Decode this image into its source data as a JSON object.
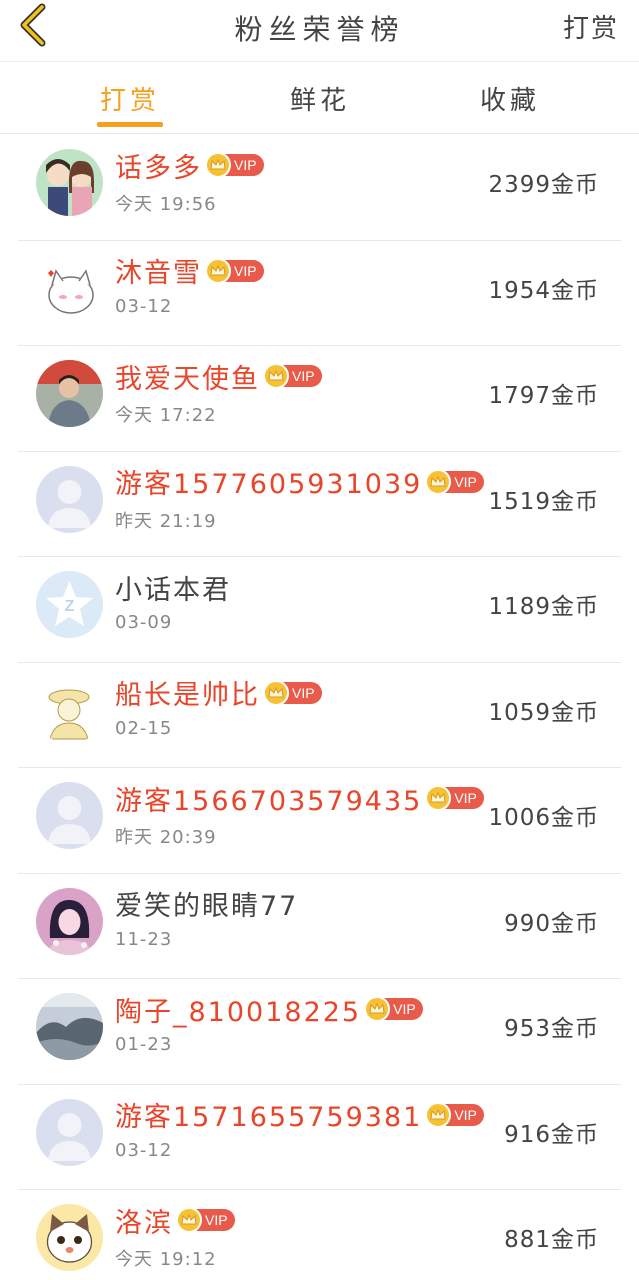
{
  "header": {
    "title": "粉丝荣誉榜",
    "action": "打赏"
  },
  "tabs": [
    {
      "label": "打赏",
      "active": true
    },
    {
      "label": "鲜花",
      "active": false
    },
    {
      "label": "收藏",
      "active": false
    }
  ],
  "colors": {
    "accent": "#f5a11f",
    "vip_name": "#e8452a",
    "vip_badge": "#e85a4a",
    "crown": "#f6c233"
  },
  "vip_badge_text": "VIP",
  "rows": [
    {
      "name": "话多多",
      "vip": true,
      "time": "今天 19:56",
      "amount": "2399金币",
      "avatar": "couple-avatar"
    },
    {
      "name": "沐音雪",
      "vip": true,
      "time": "03-12",
      "amount": "1954金币",
      "avatar": "cat-avatar"
    },
    {
      "name": "我爱天使鱼",
      "vip": true,
      "time": "今天 17:22",
      "amount": "1797金币",
      "avatar": "person-avatar"
    },
    {
      "name": "游客1577605931039",
      "vip": true,
      "time": "昨天 21:19",
      "amount": "1519金币",
      "avatar": "default-avatar"
    },
    {
      "name": "小话本君",
      "vip": false,
      "time": "03-09",
      "amount": "1189金币",
      "avatar": "qq-avatar"
    },
    {
      "name": "船长是帅比",
      "vip": true,
      "time": "02-15",
      "amount": "1059金币",
      "avatar": "sketch-avatar"
    },
    {
      "name": "游客1566703579435",
      "vip": true,
      "time": "昨天 20:39",
      "amount": "1006金币",
      "avatar": "default-avatar"
    },
    {
      "name": "爱笑的眼睛77",
      "vip": false,
      "time": "11-23",
      "amount": "990金币",
      "avatar": "girl-avatar"
    },
    {
      "name": "陶子_810018225",
      "vip": true,
      "time": "01-23",
      "amount": "953金币",
      "avatar": "landscape-avatar"
    },
    {
      "name": "游客1571655759381",
      "vip": true,
      "time": "03-12",
      "amount": "916金币",
      "avatar": "default-avatar"
    },
    {
      "name": "洛滨",
      "vip": true,
      "time": "今天 19:12",
      "amount": "881金币",
      "avatar": "cartoon-cat-avatar"
    }
  ]
}
